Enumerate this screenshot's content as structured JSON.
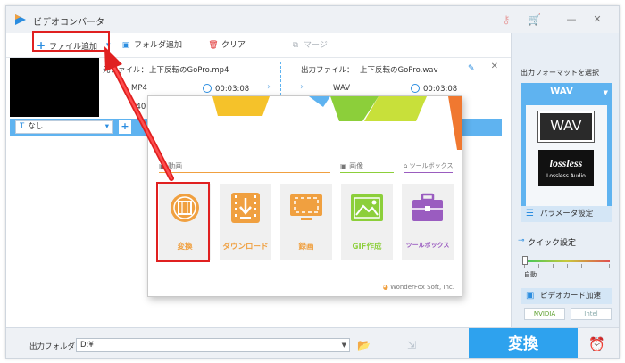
{
  "app": {
    "title": "ビデオコンバータ"
  },
  "toolbar": {
    "add_file": "ファイル追加",
    "add_folder": "フォルダ追加",
    "clear": "クリア",
    "merge": "マージ"
  },
  "file": {
    "source_label": "元ファイル：",
    "source_name": "上下反転のGoPro.mp4",
    "source_format": "MP4",
    "source_duration": "00:03:08",
    "source_resolution": "640",
    "output_label": "出力ファイル：",
    "output_name": "上下反転のGoPro.wav",
    "output_format": "WAV",
    "output_duration": "00:03:08",
    "subtitle": "なし"
  },
  "right_panel": {
    "title": "出力フォーマットを選択",
    "format": "WAV",
    "badge_text": "WAV",
    "lossless_text": "lossless",
    "lossless_sub": "Lossless Audio",
    "param_button": "パラメータ設定",
    "quick_label": "クイック設定",
    "auto_label": "自動",
    "gpu_label": "ビデオカード加速",
    "gpu_nvidia": "NVIDIA",
    "gpu_intel": "Intel"
  },
  "bottom": {
    "output_folder_label": "出力フォルダ：",
    "output_folder_value": "D:¥",
    "convert_button": "変換"
  },
  "launcher": {
    "section_video": "動画",
    "section_image": "画像",
    "section_tools": "ツールボックス",
    "tiles": [
      {
        "label": "変換",
        "color": "#f0a040"
      },
      {
        "label": "ダウンロード",
        "color": "#f0a040"
      },
      {
        "label": "録画",
        "color": "#f0a040"
      },
      {
        "label": "GIF作成",
        "color": "#8ccf3a"
      },
      {
        "label": "ツールボックス",
        "color": "#9a5cc0"
      }
    ],
    "copyright": "WonderFox Soft, Inc."
  },
  "colors": {
    "accent": "#2ea2ee",
    "highlight": "#e02020",
    "orange": "#f0a040",
    "green": "#8ccf3a",
    "purple": "#9a5cc0"
  }
}
